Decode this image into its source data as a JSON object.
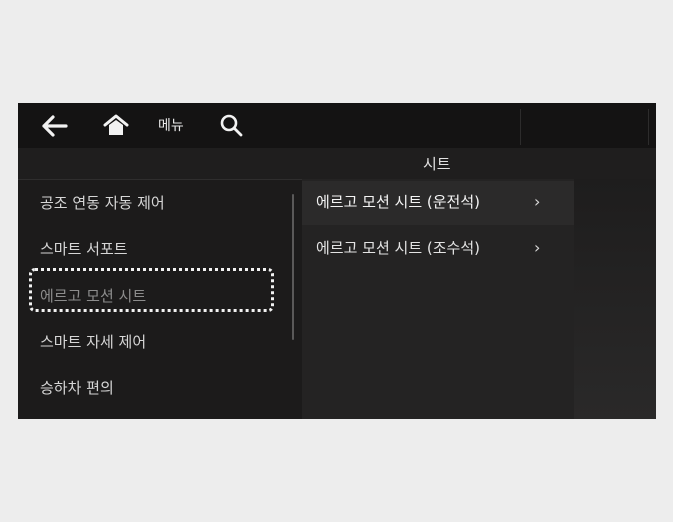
{
  "header": {
    "menu_label": "메뉴",
    "back_icon": "arrow-left-icon",
    "home_icon": "home-icon",
    "search_icon": "search-icon"
  },
  "title": "시트",
  "left_menu": {
    "items": [
      {
        "label": "공조 연동 자동 제어"
      },
      {
        "label": "스마트 서포트"
      },
      {
        "label": "에르고 모션 시트"
      },
      {
        "label": "스마트 자세 제어"
      },
      {
        "label": "승하차 편의"
      }
    ],
    "selected_index": 2
  },
  "right_menu": {
    "items": [
      {
        "label": "에르고 모션 시트 (운전석)",
        "chevron": "›"
      },
      {
        "label": "에르고 모션 시트 (조수석)",
        "chevron": "›"
      }
    ]
  },
  "colors": {
    "screen_background": "#1c1b1b",
    "text": "#d6d6d6",
    "focus_outline": "#f2f2f2"
  }
}
